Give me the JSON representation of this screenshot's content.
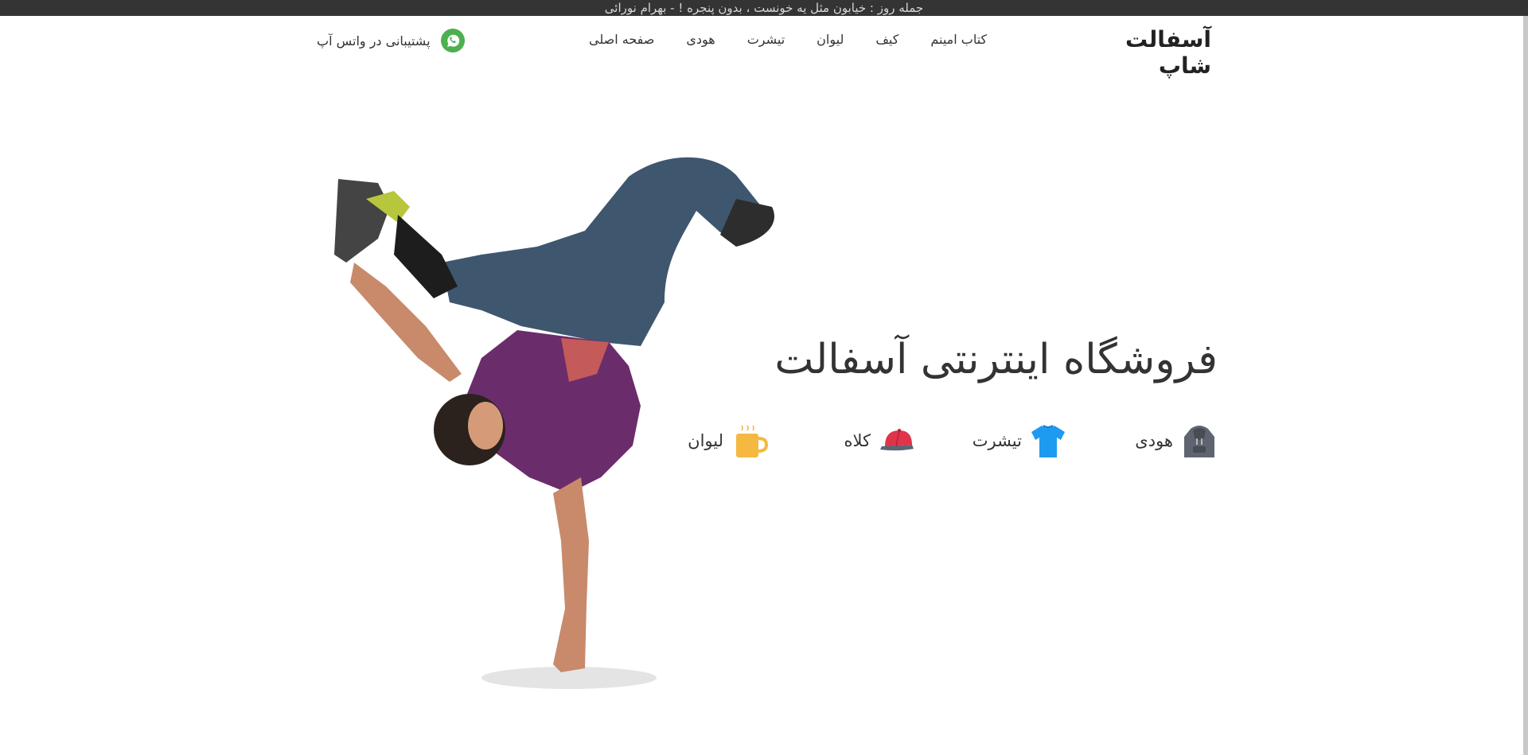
{
  "topbar": {
    "quote": "جمله روز : خیابون مثل یه خونست ، بدون پنجره ! - بهرام نورائی"
  },
  "header": {
    "logo": "آسفالت شاپ"
  },
  "nav": {
    "items": [
      "صفحه اصلی",
      "هودی",
      "تیشرت",
      "لیوان",
      "کیف",
      "کتاب امینم"
    ]
  },
  "support": {
    "label": "پشتیبانی در واتس آپ",
    "icon": "whatsapp-icon",
    "color": "#4caf50"
  },
  "hero": {
    "title": "فروشگاه اینترنتی آسفالت",
    "image": "breakdancer-photo"
  },
  "categories": [
    {
      "label": "هودی",
      "icon": "hoodie-icon",
      "color": "#5f6570"
    },
    {
      "label": "تیشرت",
      "icon": "tshirt-icon",
      "color": "#1e9bf0"
    },
    {
      "label": "کلاه",
      "icon": "cap-icon",
      "color": "#e0344a"
    },
    {
      "label": "لیوان",
      "icon": "mug-icon",
      "color": "#f5b942"
    }
  ]
}
